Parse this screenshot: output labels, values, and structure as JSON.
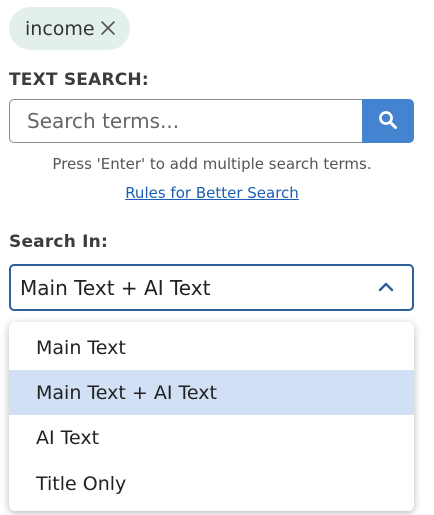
{
  "filter_chip": {
    "label": "income",
    "close_icon": "close-icon"
  },
  "text_search": {
    "label": "TEXT SEARCH:",
    "placeholder": "Search terms...",
    "value": "",
    "button_icon": "search-icon",
    "hint": "Press 'Enter' to add multiple search terms.",
    "rules_link": "Rules for Better Search"
  },
  "search_in": {
    "label": "Search In:",
    "selected": "Main Text + AI Text",
    "chevron_icon": "chevron-up-icon",
    "options": [
      {
        "label": "Main Text"
      },
      {
        "label": "Main Text + AI Text"
      },
      {
        "label": "AI Text"
      },
      {
        "label": "Title Only"
      }
    ]
  },
  "colors": {
    "chip_bg": "#e3efe9",
    "accent": "#4383cf",
    "select_border": "#2f5f9a",
    "option_highlight": "#d2e0f5",
    "link": "#1a5fb4"
  }
}
